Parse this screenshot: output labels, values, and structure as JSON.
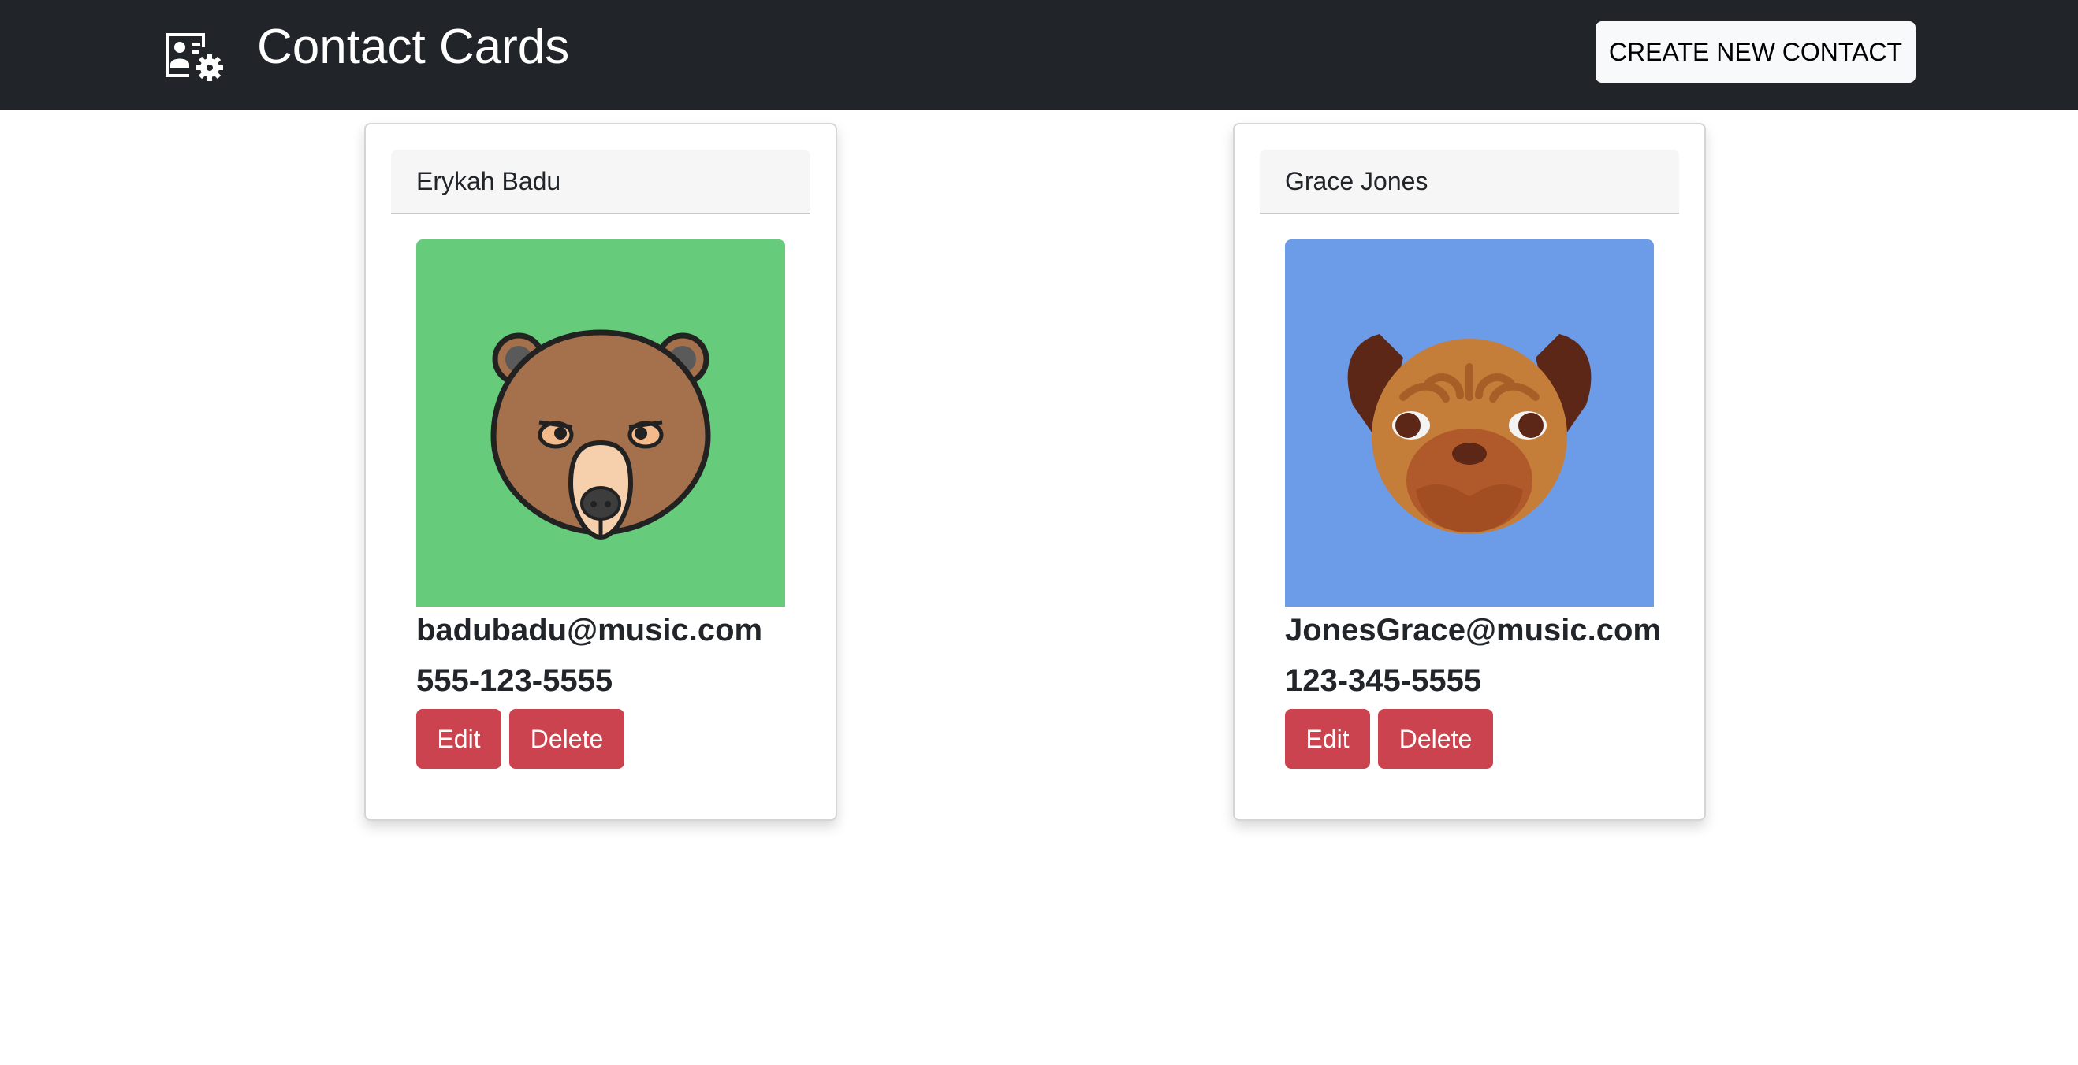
{
  "header": {
    "title": "Contact Cards",
    "logo_icon": "contact-card-icon",
    "create_button_label": "CREATE NEW CONTACT",
    "background_color": "#212529"
  },
  "contacts": [
    {
      "name": "Erykah Badu",
      "email": "badubadu@music.com",
      "phone": "555-123-5555",
      "avatar_icon": "bear-icon",
      "avatar_background": "#66cb7a",
      "edit_label": "Edit",
      "delete_label": "Delete"
    },
    {
      "name": "Grace Jones",
      "email": "JonesGrace@music.com",
      "phone": "123-345-5555",
      "avatar_icon": "pug-icon",
      "avatar_background": "#6c9be8",
      "edit_label": "Edit",
      "delete_label": "Delete"
    }
  ],
  "colors": {
    "danger_button": "#cb434e",
    "create_button": "#f8f9fa"
  }
}
